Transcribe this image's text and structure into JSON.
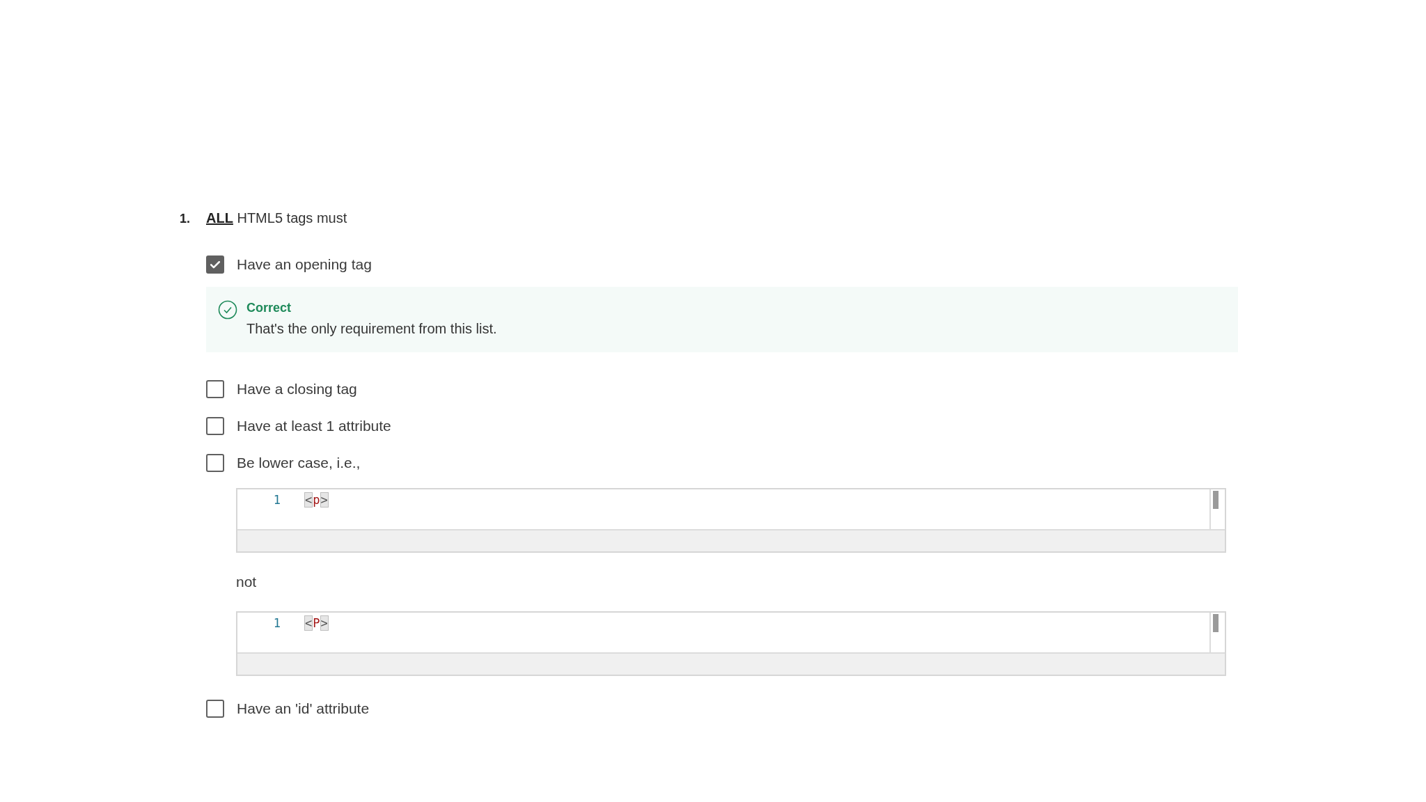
{
  "question": {
    "number": "1.",
    "text": "**ALL** HTML5 tags must",
    "options": [
      {
        "label": "Have an opening tag",
        "checked": true,
        "feedback": {
          "kind": "correct",
          "title": "Correct",
          "message": "That's the only requirement from this list."
        }
      },
      {
        "label": "Have a closing tag",
        "checked": false
      },
      {
        "label": "Have at least 1 attribute",
        "checked": false
      },
      {
        "label": "Be lower case, i.e.,",
        "checked": false,
        "details": [
          {
            "kind": "code",
            "line_number": "1",
            "tokens": [
              {
                "kind": "bracket",
                "text": "<"
              },
              {
                "kind": "tag",
                "text": "p"
              },
              {
                "kind": "bracket",
                "text": ">"
              }
            ]
          },
          {
            "kind": "text",
            "text": "not"
          },
          {
            "kind": "code",
            "line_number": "1",
            "tokens": [
              {
                "kind": "bracket",
                "text": "<"
              },
              {
                "kind": "tag",
                "text": "P"
              },
              {
                "kind": "bracket",
                "text": ">"
              }
            ]
          }
        ]
      },
      {
        "label": "Have an 'id' attribute",
        "checked": false
      }
    ]
  }
}
